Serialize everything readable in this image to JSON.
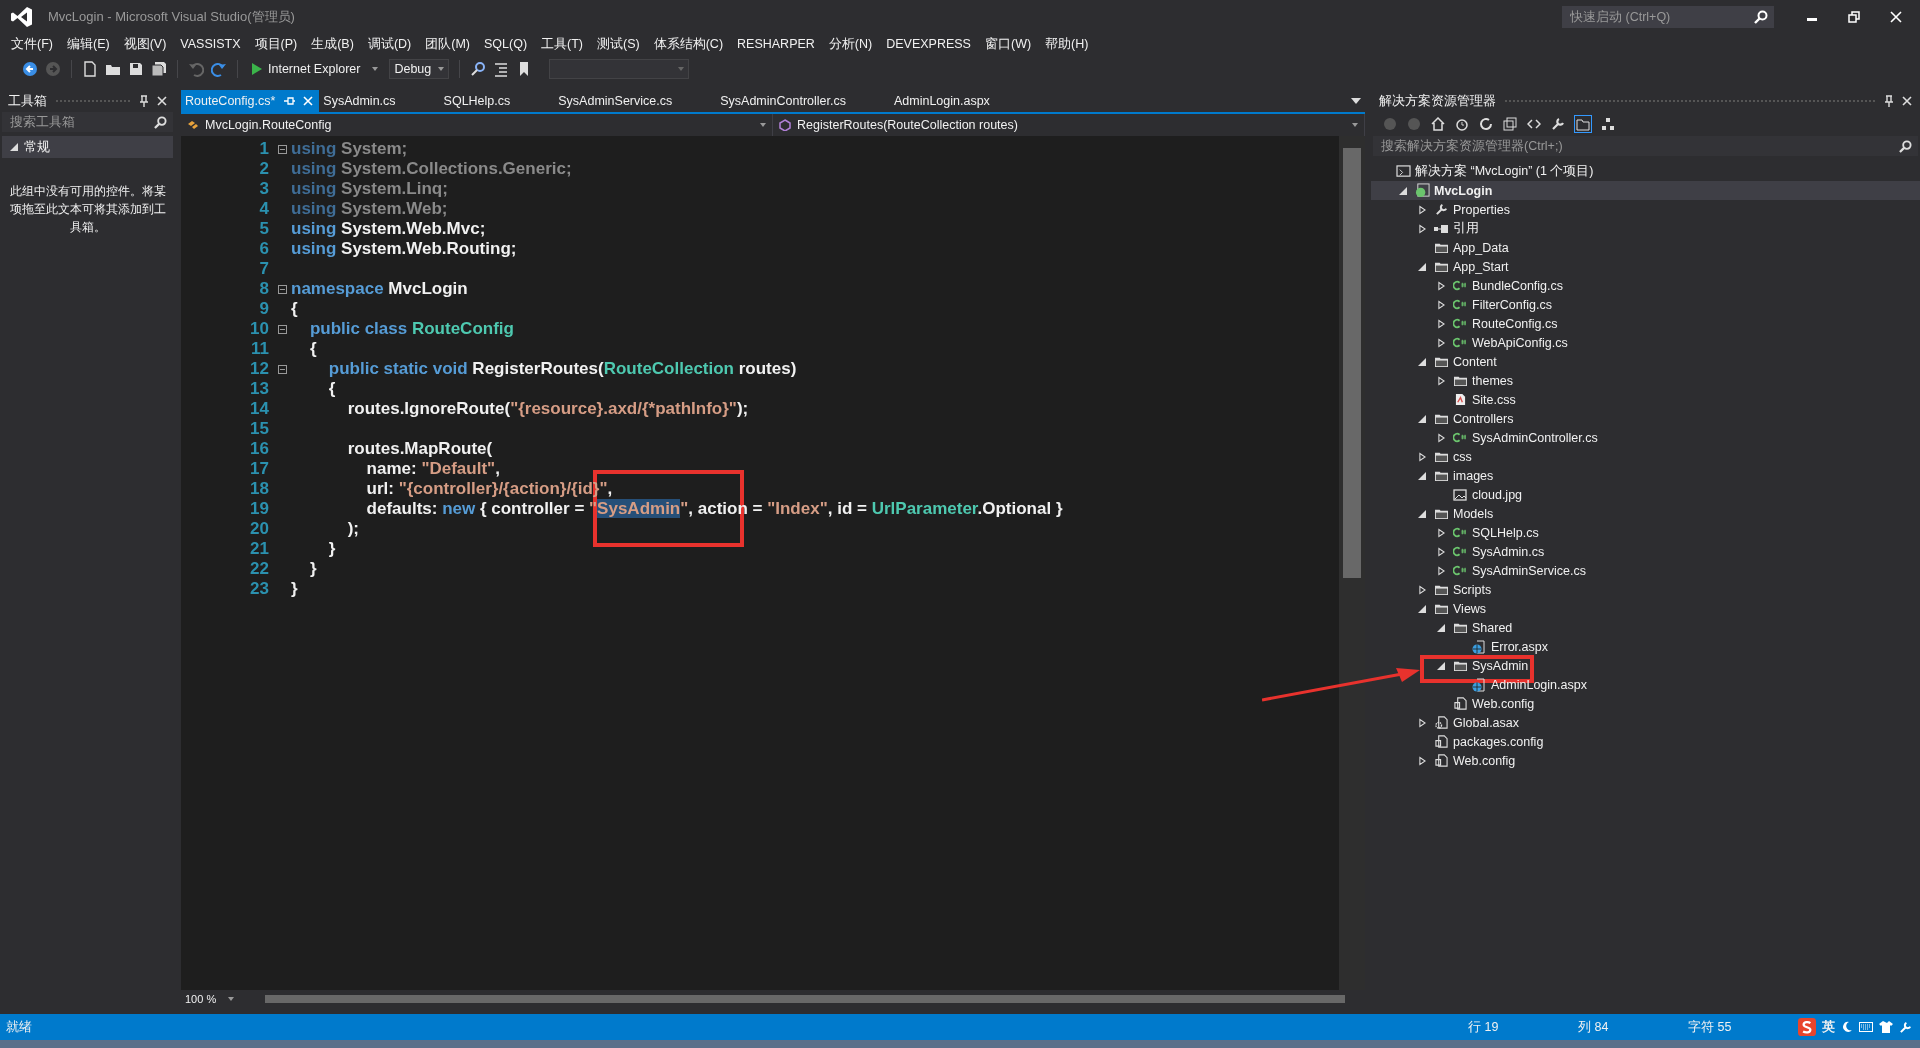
{
  "window": {
    "title": "MvcLogin - Microsoft Visual Studio(管理员)",
    "quick_launch": {
      "placeholder": "快速启动 (Ctrl+Q)"
    }
  },
  "menu": [
    "文件(F)",
    "编辑(E)",
    "视图(V)",
    "VASSISTX",
    "项目(P)",
    "生成(B)",
    "调试(D)",
    "团队(M)",
    "SQL(Q)",
    "工具(T)",
    "测试(S)",
    "体系结构(C)",
    "RESHARPER",
    "分析(N)",
    "DEVEXPRESS",
    "窗口(W)",
    "帮助(H)"
  ],
  "toolbar": {
    "run_target": "Internet Explorer",
    "configuration": "Debug"
  },
  "toolbox": {
    "title": "工具箱",
    "search": {
      "placeholder": "搜索工具箱"
    },
    "group": {
      "label": "常规",
      "expanded": true
    },
    "empty_message": "此组中没有可用的控件。将某项拖至此文本可将其添加到工具箱。"
  },
  "tabs": [
    {
      "label": "RouteConfig.cs*",
      "selected": true
    },
    {
      "label": "SysAdmin.cs",
      "selected": false
    },
    {
      "label": "SQLHelp.cs",
      "selected": false
    },
    {
      "label": "SysAdminService.cs",
      "selected": false
    },
    {
      "label": "SysAdminController.cs",
      "selected": false
    },
    {
      "label": "AdminLogin.aspx",
      "selected": false
    }
  ],
  "navigation": {
    "type": "MvcLogin.RouteConfig",
    "member": "RegisterRoutes(RouteCollection routes)"
  },
  "editor": {
    "zoom": "100 %",
    "lines": [
      {
        "number": "1",
        "fold": true,
        "tokens": [
          {
            "kind": "dim-keyword",
            "text": "using"
          },
          {
            "kind": "dim",
            "text": " System;"
          }
        ]
      },
      {
        "number": "2",
        "fold": false,
        "tokens": [
          {
            "kind": "dim-keyword",
            "text": "using"
          },
          {
            "kind": "dim",
            "text": " System.Collections.Generic;"
          }
        ]
      },
      {
        "number": "3",
        "fold": false,
        "tokens": [
          {
            "kind": "dim-keyword",
            "text": "using"
          },
          {
            "kind": "dim",
            "text": " System.Linq;"
          }
        ]
      },
      {
        "number": "4",
        "fold": false,
        "tokens": [
          {
            "kind": "dim-keyword",
            "text": "using"
          },
          {
            "kind": "dim",
            "text": " System.Web;"
          }
        ]
      },
      {
        "number": "5",
        "fold": false,
        "tokens": [
          {
            "kind": "keyword",
            "text": "using"
          },
          {
            "kind": "plain",
            "text": " System.Web.Mvc;"
          }
        ]
      },
      {
        "number": "6",
        "fold": false,
        "tokens": [
          {
            "kind": "keyword",
            "text": "using"
          },
          {
            "kind": "plain",
            "text": " System.Web.Routing;"
          }
        ]
      },
      {
        "number": "7",
        "fold": false
      },
      {
        "number": "8",
        "fold": true,
        "tokens": [
          {
            "kind": "keyword",
            "text": "namespace"
          },
          {
            "kind": "plain",
            "text": " MvcLogin"
          }
        ]
      },
      {
        "number": "9",
        "fold": false,
        "tokens": [
          {
            "kind": "plain",
            "text": "{"
          }
        ]
      },
      {
        "number": "10",
        "fold": true,
        "tokens": [
          {
            "kind": "keyword",
            "text": "    public class"
          },
          {
            "kind": "type",
            "text": " RouteConfig"
          }
        ]
      },
      {
        "number": "11",
        "fold": false,
        "tokens": [
          {
            "kind": "plain",
            "text": "    {"
          }
        ]
      },
      {
        "number": "12",
        "fold": true,
        "tokens": [
          {
            "kind": "keyword",
            "text": "        public static void"
          },
          {
            "kind": "plain",
            "text": " RegisterRoutes("
          },
          {
            "kind": "type",
            "text": "RouteCollection"
          },
          {
            "kind": "plain",
            "text": " routes)"
          }
        ]
      },
      {
        "number": "13",
        "fold": false,
        "tokens": [
          {
            "kind": "plain",
            "text": "        {"
          }
        ]
      },
      {
        "number": "14",
        "fold": false,
        "tokens": [
          {
            "kind": "plain",
            "text": "            routes.IgnoreRoute("
          },
          {
            "kind": "string",
            "text": "\"{resource}.axd/{*pathInfo}\""
          },
          {
            "kind": "plain",
            "text": ");"
          }
        ]
      },
      {
        "number": "15",
        "fold": false
      },
      {
        "number": "16",
        "fold": false,
        "tokens": [
          {
            "kind": "plain",
            "text": "            routes.MapRoute("
          }
        ]
      },
      {
        "number": "17",
        "fold": false,
        "tokens": [
          {
            "kind": "plain",
            "text": "                name: "
          },
          {
            "kind": "string",
            "text": "\"Default\""
          },
          {
            "kind": "plain",
            "text": ","
          }
        ]
      },
      {
        "number": "18",
        "fold": false,
        "tokens": [
          {
            "kind": "plain",
            "text": "                url: "
          },
          {
            "kind": "string",
            "text": "\"{controller}/{action}/{id}\""
          },
          {
            "kind": "plain",
            "text": ","
          }
        ]
      },
      {
        "number": "19",
        "fold": false,
        "tokens": [
          {
            "kind": "plain",
            "text": "                defaults: "
          },
          {
            "kind": "keyword",
            "text": "new"
          },
          {
            "kind": "plain",
            "text": " { controller = "
          },
          {
            "kind": "string",
            "text": "\""
          },
          {
            "kind": "selected-string",
            "text": "SysAdmin"
          },
          {
            "kind": "string",
            "text": "\""
          },
          {
            "kind": "plain",
            "text": ", action = "
          },
          {
            "kind": "string",
            "text": "\"Index\""
          },
          {
            "kind": "plain",
            "text": ", id = "
          },
          {
            "kind": "type",
            "text": "UrlParameter"
          },
          {
            "kind": "plain",
            "text": ".Optional }"
          }
        ]
      },
      {
        "number": "20",
        "fold": false,
        "tokens": [
          {
            "kind": "plain",
            "text": "            );"
          }
        ]
      },
      {
        "number": "21",
        "fold": false,
        "tokens": [
          {
            "kind": "plain",
            "text": "        }"
          }
        ]
      },
      {
        "number": "22",
        "fold": false,
        "tokens": [
          {
            "kind": "plain",
            "text": "    }"
          }
        ]
      },
      {
        "number": "23",
        "fold": false,
        "tokens": [
          {
            "kind": "plain",
            "text": "}"
          }
        ]
      }
    ]
  },
  "solution_explorer": {
    "title": "解决方案资源管理器",
    "search": {
      "placeholder": "搜索解决方案资源管理器(Ctrl+;)"
    },
    "tree": [
      {
        "label": "解决方案 “MvcLogin” (1 个项目)",
        "kind": "solution",
        "selected": false,
        "children": [
          {
            "label": "MvcLogin",
            "kind": "project",
            "expanded": true,
            "selected": true,
            "children": [
              {
                "label": "Properties",
                "kind": "properties",
                "expanded": false,
                "selected": false
              },
              {
                "label": "引用",
                "kind": "references",
                "expanded": false,
                "selected": false
              },
              {
                "label": "App_Data",
                "kind": "folder",
                "selected": false
              },
              {
                "label": "App_Start",
                "kind": "folder",
                "expanded": true,
                "selected": false,
                "children": [
                  {
                    "label": "BundleConfig.cs",
                    "kind": "csharp",
                    "expanded": false,
                    "selected": false
                  },
                  {
                    "label": "FilterConfig.cs",
                    "kind": "csharp",
                    "expanded": false,
                    "selected": false
                  },
                  {
                    "label": "RouteConfig.cs",
                    "kind": "csharp",
                    "expanded": false,
                    "selected": false
                  },
                  {
                    "label": "WebApiConfig.cs",
                    "kind": "csharp",
                    "expanded": false,
                    "selected": false
                  }
                ]
              },
              {
                "label": "Content",
                "kind": "folder",
                "expanded": true,
                "selected": false,
                "children": [
                  {
                    "label": "themes",
                    "kind": "folder",
                    "expanded": false,
                    "selected": false
                  },
                  {
                    "label": "Site.css",
                    "kind": "stylesheet",
                    "selected": false
                  }
                ]
              },
              {
                "label": "Controllers",
                "kind": "folder",
                "expanded": true,
                "selected": false,
                "children": [
                  {
                    "label": "SysAdminController.cs",
                    "kind": "csharp",
                    "expanded": false,
                    "selected": false
                  }
                ]
              },
              {
                "label": "css",
                "kind": "folder",
                "expanded": false,
                "selected": false
              },
              {
                "label": "images",
                "kind": "folder",
                "expanded": true,
                "selected": false,
                "children": [
                  {
                    "label": "cloud.jpg",
                    "kind": "image",
                    "selected": false
                  }
                ]
              },
              {
                "label": "Models",
                "kind": "folder",
                "expanded": true,
                "selected": false,
                "children": [
                  {
                    "label": "SQLHelp.cs",
                    "kind": "csharp",
                    "expanded": false,
                    "selected": false
                  },
                  {
                    "label": "SysAdmin.cs",
                    "kind": "csharp",
                    "expanded": false,
                    "selected": false
                  },
                  {
                    "label": "SysAdminService.cs",
                    "kind": "csharp",
                    "expanded": false,
                    "selected": false
                  }
                ]
              },
              {
                "label": "Scripts",
                "kind": "folder",
                "expanded": false,
                "selected": false
              },
              {
                "label": "Views",
                "kind": "folder",
                "expanded": true,
                "selected": false,
                "children": [
                  {
                    "label": "Shared",
                    "kind": "folder",
                    "expanded": true,
                    "selected": false,
                    "children": [
                      {
                        "label": "Error.aspx",
                        "kind": "webpage",
                        "selected": false
                      }
                    ]
                  },
                  {
                    "label": "SysAdmin",
                    "kind": "folder",
                    "expanded": true,
                    "selected": false,
                    "children": [
                      {
                        "label": "AdminLogin.aspx",
                        "kind": "webpage",
                        "selected": false
                      }
                    ]
                  },
                  {
                    "label": "Web.config",
                    "kind": "config",
                    "selected": false
                  }
                ]
              },
              {
                "label": "Global.asax",
                "kind": "asax",
                "expanded": false,
                "selected": false
              },
              {
                "label": "packages.config",
                "kind": "config",
                "selected": false
              },
              {
                "label": "Web.config",
                "kind": "config",
                "expanded": false,
                "selected": false
              }
            ]
          }
        ]
      }
    ]
  },
  "status_bar": {
    "message": "就绪",
    "line": "行 19",
    "column": "列 84",
    "char": "字符 55",
    "ime": "英"
  }
}
